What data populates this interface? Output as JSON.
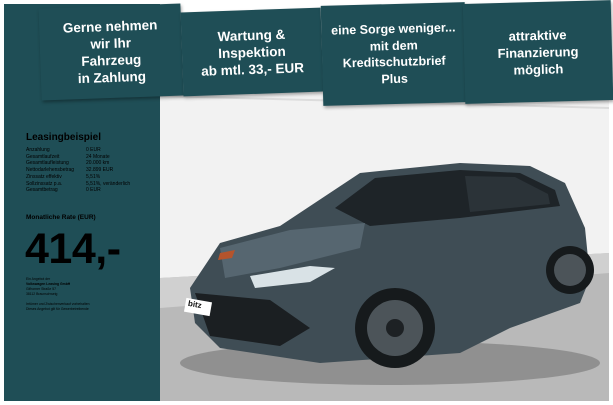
{
  "banners": [
    {
      "lines": [
        "Gerne nehmen",
        "wir Ihr",
        "Fahrzeug",
        "in Zahlung"
      ]
    },
    {
      "lines": [
        "Wartung &",
        "Inspektion",
        "ab mtl. 33,- EUR"
      ]
    },
    {
      "lines": [
        "eine Sorge weniger...",
        "mit dem",
        "Kreditschutzbrief",
        "Plus"
      ]
    },
    {
      "lines": [
        "attraktive",
        "Finanzierung",
        "möglich"
      ]
    }
  ],
  "leasing": {
    "title": "Leasingbeispiel",
    "rows": [
      {
        "label": "Anzahlung",
        "value": "0 EUR"
      },
      {
        "label": "Gesamtlaufzeit",
        "value": "24 Monate"
      },
      {
        "label": "Gesamtlaufleistung",
        "value": "20.000 km"
      },
      {
        "label": "Nettodarlehensbetrag",
        "value": "32.899 EUR"
      },
      {
        "label": "Zinssatz effektiv",
        "value": "5,51%"
      },
      {
        "label": "Sollzinssatz p.a.",
        "value": "5,51%, veränderlich"
      },
      {
        "label": "Gesamtbetrag",
        "value": "0 EUR"
      }
    ],
    "rate_label": "Monatliche Rate (EUR)",
    "rate_value": "414,-",
    "provider_lines": [
      "Ein Angebot der",
      "Volkswagen Leasing GmbH",
      "Gifhorner Straße 57",
      "38112 Braunschweig"
    ],
    "disclaimer_lines": [
      "Irrtümer und Zwischenverkauf vorbehalten",
      "Dieses Angebot gilt für Gewerbetreibende"
    ]
  },
  "photo": {
    "plate_text": "bitz",
    "colors": {
      "car_body": "#3f4d55",
      "panel": "#1f4e56",
      "accent": "#b5542c"
    }
  }
}
